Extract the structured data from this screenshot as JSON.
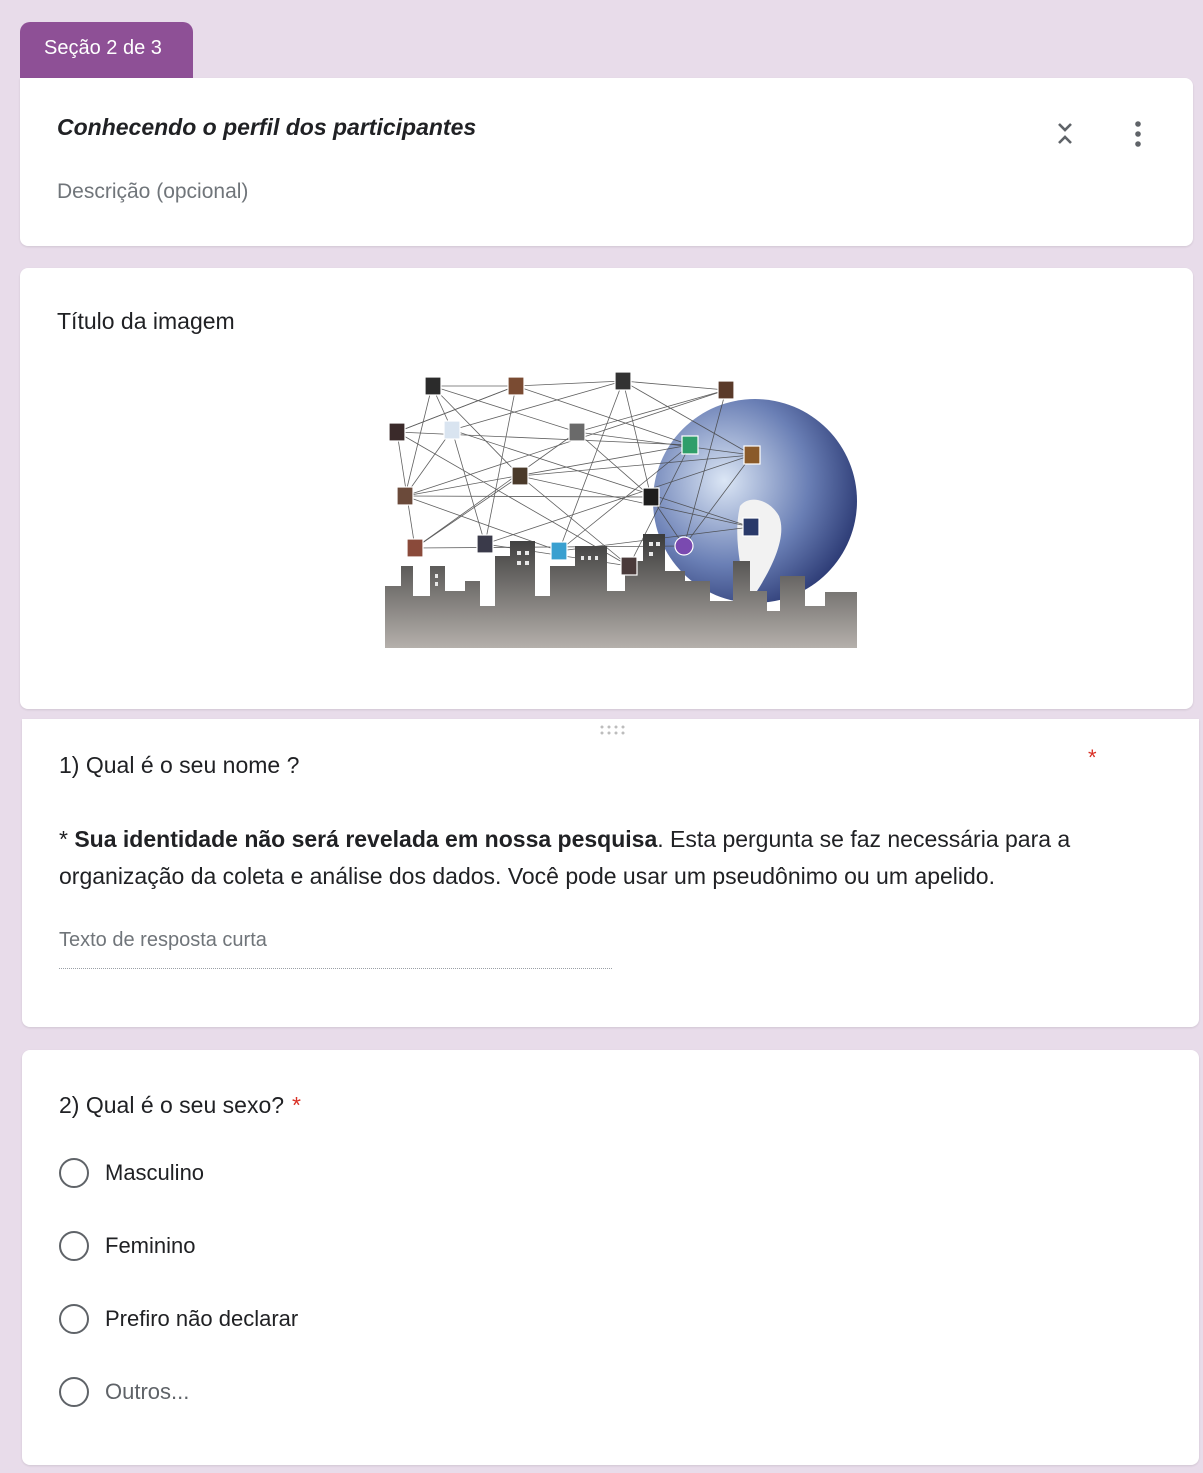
{
  "section_tab": {
    "label": "Seção 2 de 3"
  },
  "section_header": {
    "title": "Conhecendo o perfil dos participantes",
    "description_placeholder": "Descrição (opcional)",
    "collapse_icon": "collapse-icon",
    "more_icon": "more-vert-icon"
  },
  "image_item": {
    "title": "Título da imagem",
    "image_icon": "social-network-globe-city-image"
  },
  "question1": {
    "title": "1) Qual é o seu nome ?",
    "required_mark": "*",
    "desc_prefix": "* ",
    "desc_bold": "Sua identidade não será revelada em nossa pesquisa",
    "desc_rest": ". Esta pergunta se faz necessária para a organização da coleta e análise dos dados. Você pode usar um pseudônimo ou um apelido.",
    "answer_placeholder": "Texto de resposta curta"
  },
  "question2": {
    "title": "2) Qual é o seu sexo?",
    "required_mark": "*",
    "options": [
      "Masculino",
      "Feminino",
      "Prefiro não declarar"
    ],
    "other_label": "Outros..."
  },
  "colors": {
    "accent": "#8e5096",
    "background": "#e8dcea",
    "required": "#d93025"
  }
}
